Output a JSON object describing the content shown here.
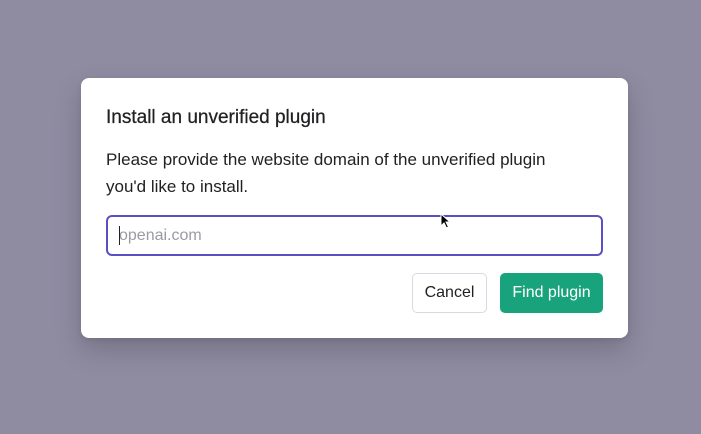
{
  "dialog": {
    "title": "Install an unverified plugin",
    "description": "Please provide the website domain of the unverified plugin you'd like to install.",
    "domain_input": {
      "value": "",
      "placeholder": "openai.com"
    },
    "cancel_label": "Cancel",
    "find_label": "Find plugin"
  },
  "colors": {
    "backdrop": "#8f8ca2",
    "input_focus_border": "#5b4fc4",
    "primary_button": "#19a37c"
  },
  "icons": {
    "mouse_pointer": "arrow-cursor-icon"
  }
}
